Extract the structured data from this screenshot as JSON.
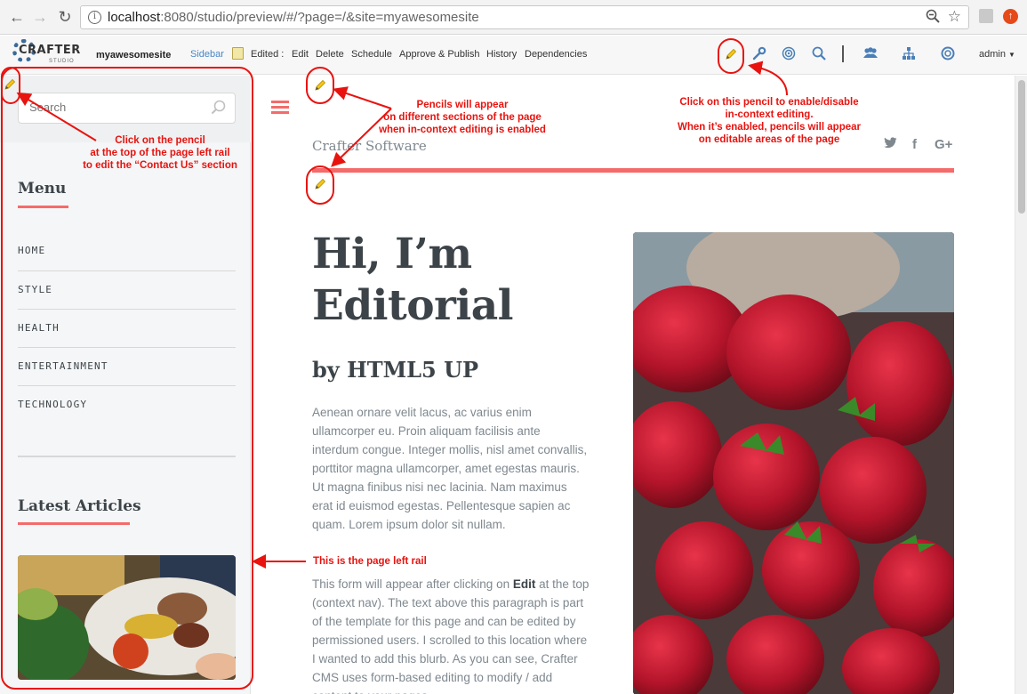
{
  "browser": {
    "url_host": "localhost",
    "url_path": ":8080/studio/preview/#/?page=/&site=myawesomesite",
    "back_icon": "←",
    "forward_icon": "→",
    "reload_icon": "↻",
    "star_icon": "☆"
  },
  "studio": {
    "logo_word": "CRAFTER",
    "logo_sub": "STUDIO",
    "site_name": "myawesomesite",
    "context_nav": {
      "sidebar": "Sidebar",
      "edited": "Edited :",
      "edit": "Edit",
      "delete": "Delete",
      "schedule": "Schedule",
      "approve": "Approve & Publish",
      "history": "History",
      "dependencies": "Dependencies"
    },
    "user": "admin"
  },
  "rail": {
    "search_placeholder": "Search",
    "menu_title": "Menu",
    "menu_items": [
      "HOME",
      "STYLE",
      "HEALTH",
      "ENTERTAINMENT",
      "TECHNOLOGY"
    ],
    "latest_title": "Latest Articles"
  },
  "main": {
    "brand": "Crafter Software",
    "social": [
      "𝕏",
      "f",
      "G+"
    ],
    "heading": "Hi, I’m Editorial",
    "subheading": "by HTML5 UP",
    "paragraph1": "Aenean ornare velit lacus, ac varius enim ullamcorper eu. Proin aliquam facilisis ante interdum congue. Integer mollis, nisl amet convallis, porttitor magna ullamcorper, amet egestas mauris. Ut magna finibus nisi nec lacinia. Nam maximus erat id euismod egestas. Pellentesque sapien ac quam. Lorem ipsum dolor sit nullam.",
    "paragraph2_before": "This form will appear after clicking on ",
    "paragraph2_bold": "Edit",
    "paragraph2_after": " at the top (context nav).  The text above this paragraph is part of the template for this page and can be edited by permissioned users.  I scrolled to this location where I wanted to add this blurb.  As you can see, Crafter CMS uses form-based editing to modify / add content to your pages."
  },
  "annotations": {
    "note_rail_pencil": "Click on the pencil\nat the top of the page left rail\nto edit the “Contact Us” section",
    "note_sections": "Pencils will appear\non different sections of the page\nwhen in-context editing is enabled",
    "note_toolbar": "Click on this pencil to enable/disable\nin-context editing.\nWhen it’s enabled, pencils will appear\non editable areas of the page",
    "note_rail": "This is the page left rail"
  },
  "colors": {
    "accent": "#f56a6a",
    "annotation": "#e8130f",
    "pencil": "#f5c518",
    "studio_blue": "#4a7fb8"
  }
}
